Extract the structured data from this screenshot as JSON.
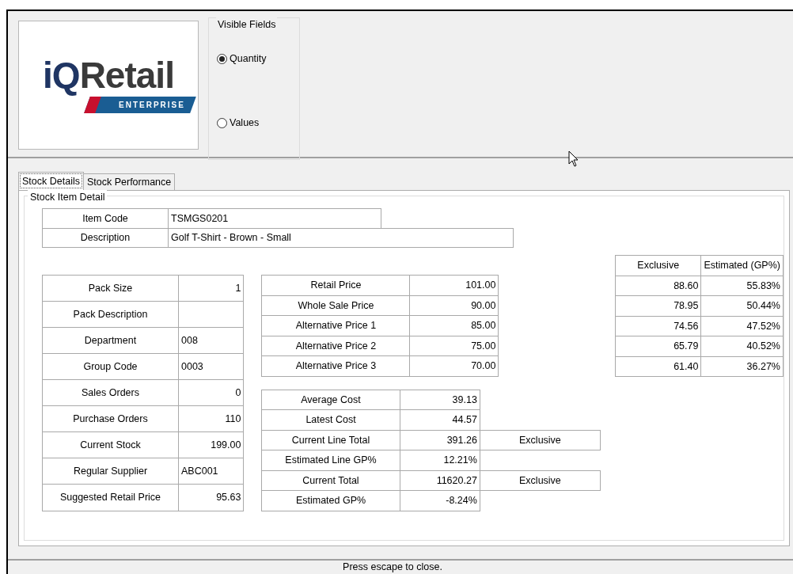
{
  "logo": {
    "mark": "iQ",
    "name": "Retail",
    "edition": "ENTERPRISE"
  },
  "visible_fields": {
    "title": "Visible Fields",
    "options": [
      {
        "label": "Quantity",
        "selected": true
      },
      {
        "label": "Values",
        "selected": false
      }
    ]
  },
  "tabs": [
    {
      "label": "Stock Details",
      "selected": true
    },
    {
      "label": "Stock Performance",
      "selected": false
    }
  ],
  "detail": {
    "title": "Stock Item Detail",
    "item": [
      {
        "label": "Item Code",
        "value": "TSMGS0201",
        "kind": "short"
      },
      {
        "label": "Description",
        "value": "Golf T-Shirt - Brown - Small",
        "kind": "long"
      }
    ],
    "stock": [
      {
        "label": "Pack Size",
        "value": "1",
        "kind": "number"
      },
      {
        "label": "Pack Description",
        "kind": "code"
      },
      {
        "label": "Department",
        "value": "008",
        "kind": "code"
      },
      {
        "label": "Group Code",
        "value": "0003",
        "kind": "code"
      },
      {
        "label": "Sales Orders",
        "value": "0",
        "kind": "number"
      },
      {
        "label": "Purchase Orders",
        "value": "110",
        "kind": "number"
      },
      {
        "label": "Current Stock",
        "value": "199.00",
        "kind": "number"
      },
      {
        "label": "Regular Supplier",
        "value": "ABC001",
        "kind": "code"
      },
      {
        "label": "Suggested Retail Price",
        "value": "95.63",
        "kind": "number"
      }
    ],
    "prices": [
      {
        "label": "Retail Price",
        "value": "101.00"
      },
      {
        "label": "Whole Sale Price",
        "value": "90.00"
      },
      {
        "label": "Alternative Price 1",
        "value": "85.00"
      },
      {
        "label": "Alternative Price 2",
        "value": "75.00"
      },
      {
        "label": "Alternative Price 3",
        "value": "70.00"
      }
    ],
    "price_columns": [
      "Exclusive",
      "Estimated (GP%)"
    ],
    "price_breakdown": [
      {
        "exclusive": "88.60",
        "gp": "55.83%"
      },
      {
        "exclusive": "78.95",
        "gp": "50.44%"
      },
      {
        "exclusive": "74.56",
        "gp": "47.52%"
      },
      {
        "exclusive": "65.79",
        "gp": "40.52%"
      },
      {
        "exclusive": "61.40",
        "gp": "36.27%"
      }
    ],
    "costs": [
      {
        "label": "Average Cost",
        "value": "39.13"
      },
      {
        "label": "Latest Cost",
        "value": "44.57"
      },
      {
        "label": "Current Line Total",
        "value": "391.26",
        "extra": "Exclusive"
      },
      {
        "label": "Estimated Line GP%",
        "value": "12.21%"
      },
      {
        "label": "Current Total",
        "value": "11620.27",
        "extra": "Exclusive"
      },
      {
        "label": "Estimated GP%",
        "value": "-8.24%"
      }
    ]
  },
  "status_bar": "Press escape to close."
}
